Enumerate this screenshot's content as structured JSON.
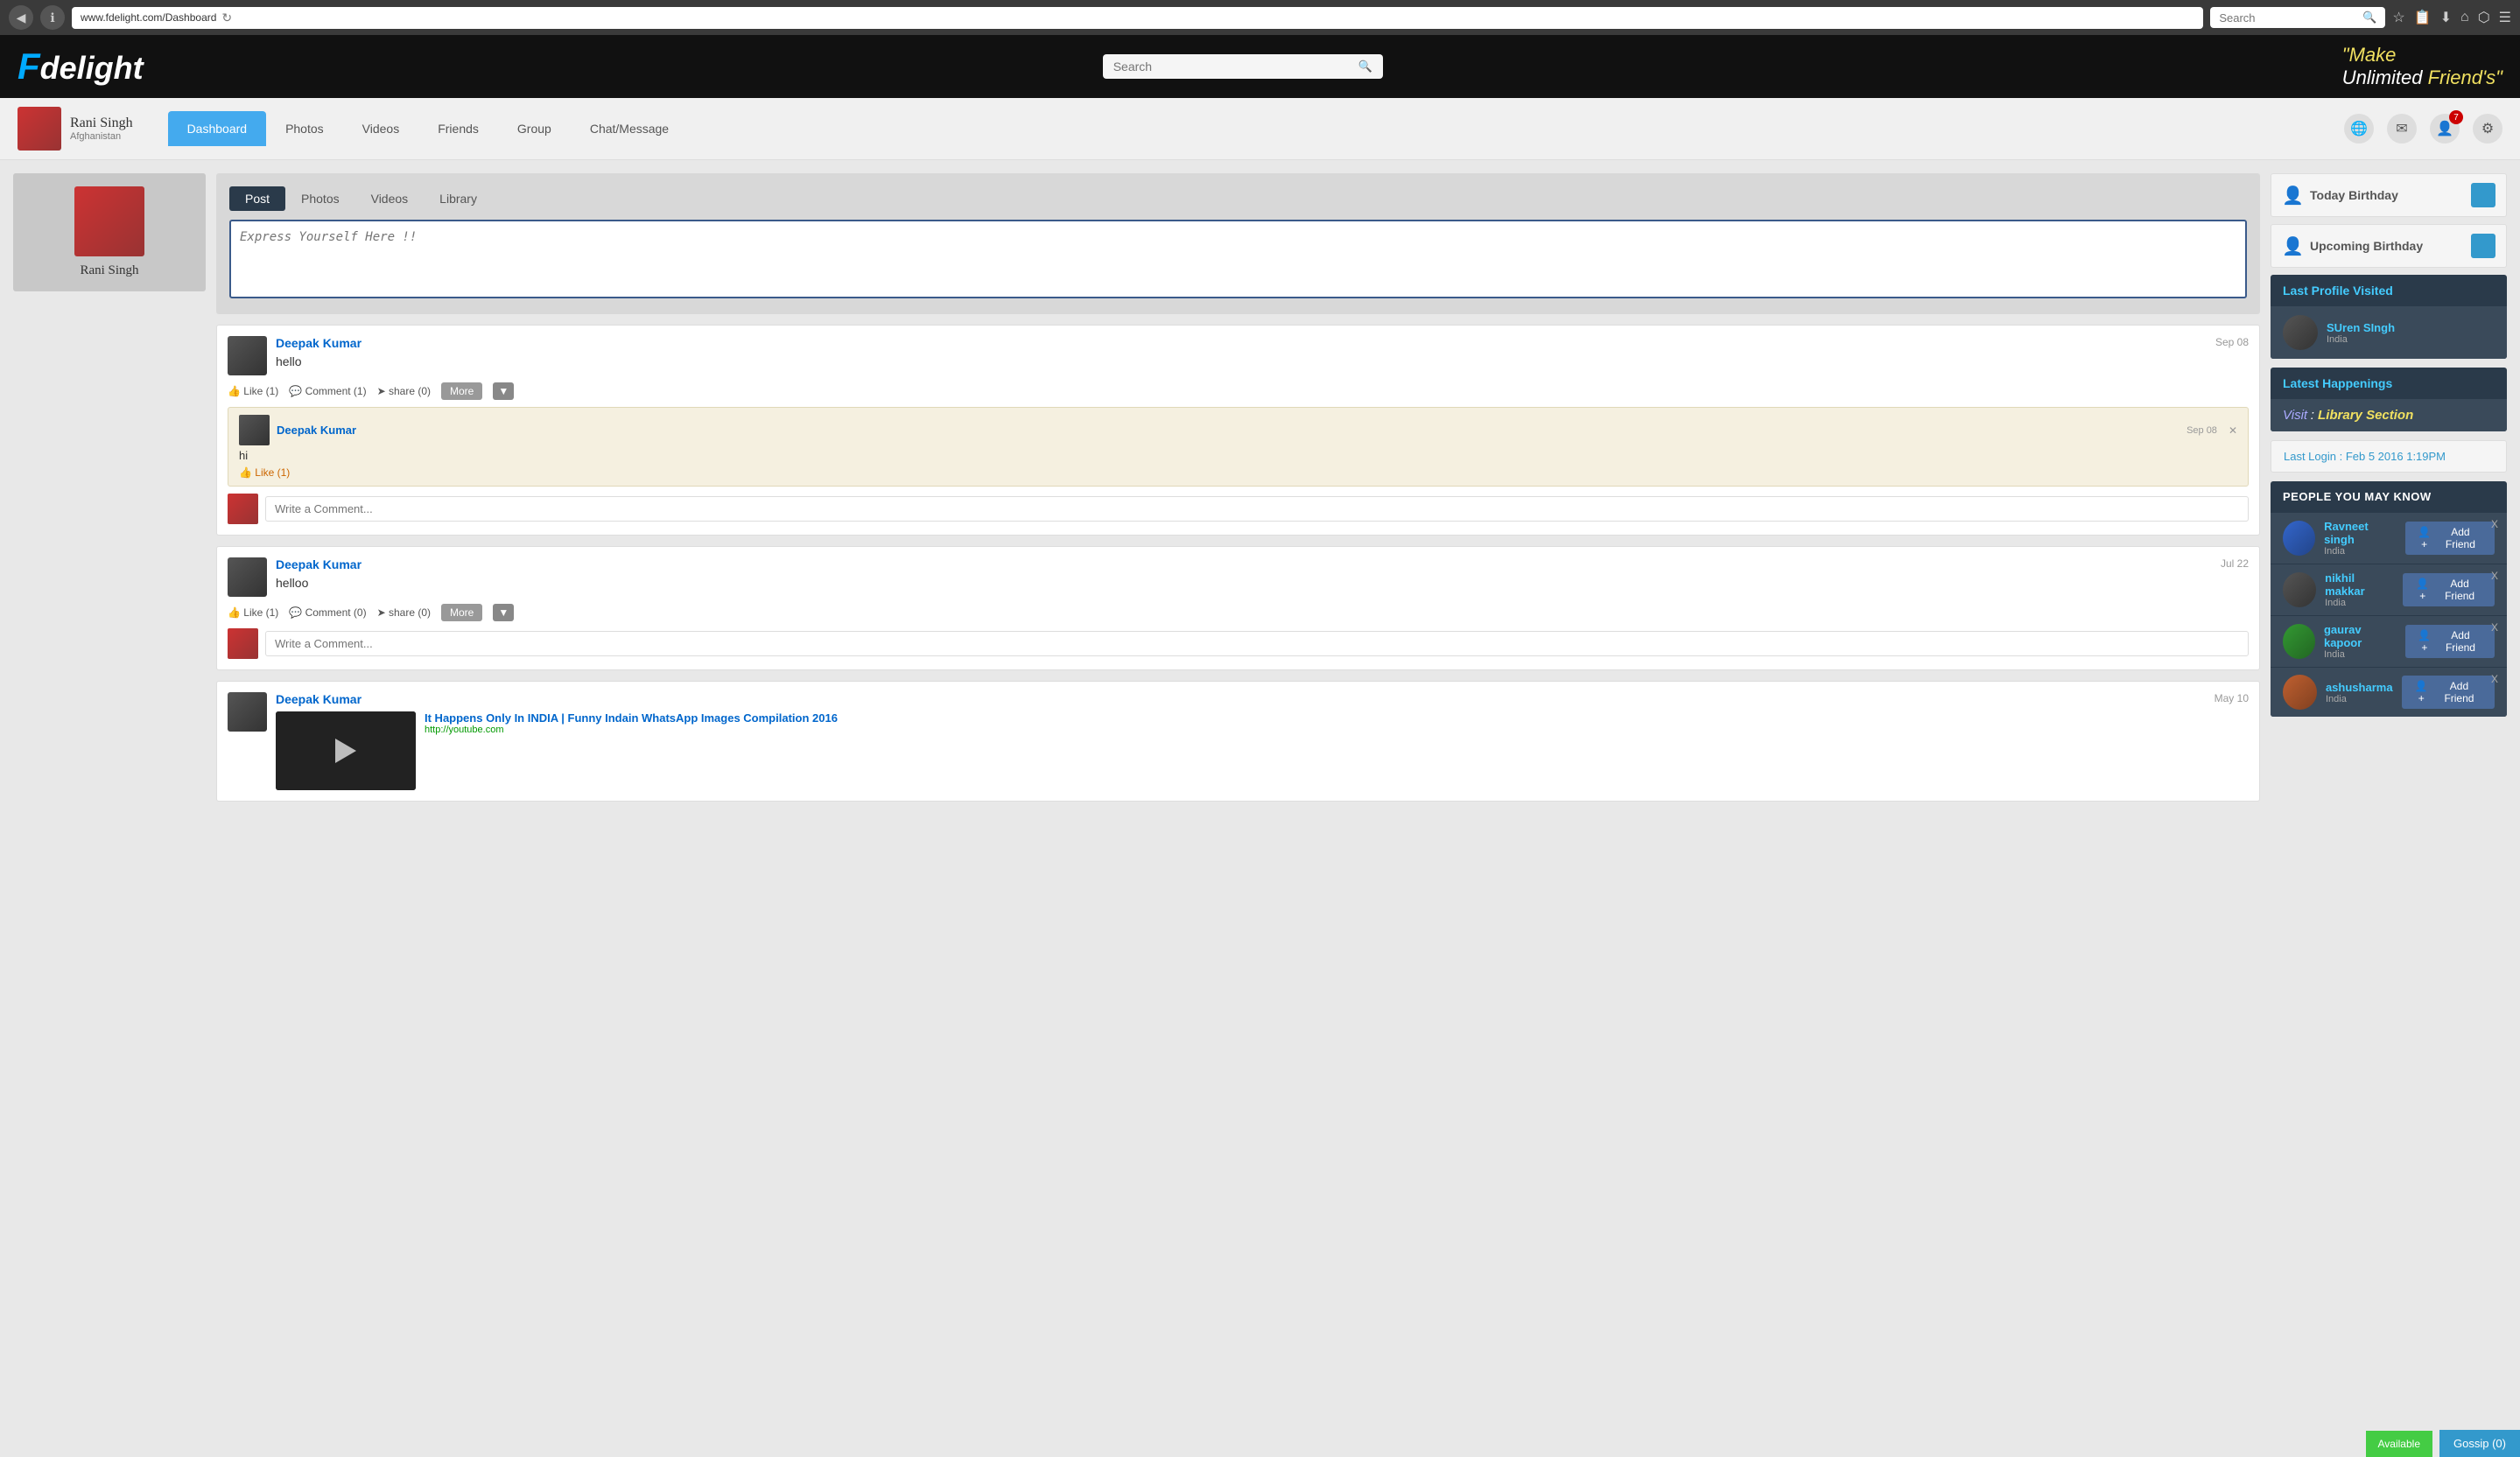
{
  "browser": {
    "url": "www.fdelight.com/Dashboard",
    "search_placeholder": "Search",
    "back_icon": "◀",
    "info_icon": "ℹ",
    "reload_icon": "↻",
    "star_icon": "☆",
    "bookmark_icon": "📋",
    "download_icon": "⬇",
    "home_icon": "⌂",
    "pocket_icon": "⬡",
    "menu_icon": "☰"
  },
  "header": {
    "logo_f": "F",
    "logo_rest": "delight",
    "search_placeholder": "Search",
    "tagline_line1": "\"Make",
    "tagline_line2": "Unlimited Friend's\""
  },
  "nav": {
    "user_name": "Rani Singh",
    "user_location": "Afghanistan",
    "tabs": [
      {
        "id": "dashboard",
        "label": "Dashboard",
        "active": true
      },
      {
        "id": "photos",
        "label": "Photos",
        "active": false
      },
      {
        "id": "videos",
        "label": "Videos",
        "active": false
      },
      {
        "id": "friends",
        "label": "Friends",
        "active": false
      },
      {
        "id": "group",
        "label": "Group",
        "active": false
      },
      {
        "id": "chat",
        "label": "Chat/Message",
        "active": false
      }
    ],
    "notification_count": "7"
  },
  "post_area": {
    "tabs": [
      "Post",
      "Photos",
      "Videos",
      "Library"
    ],
    "active_tab": "Post",
    "placeholder": "Express Yourself Here !!"
  },
  "feed": [
    {
      "id": "feed1",
      "user": "Deepak Kumar",
      "text": "hello",
      "date": "Sep 08",
      "like_count": "1",
      "comment_count": "1",
      "share_count": "0",
      "comment": {
        "user": "Deepak Kumar",
        "text": "hi",
        "date": "Sep 08",
        "like_count": "1"
      },
      "comment_placeholder": "Write a Comment..."
    },
    {
      "id": "feed2",
      "user": "Deepak Kumar",
      "text": "helloo",
      "date": "Jul 22",
      "like_count": "1",
      "comment_count": "0",
      "share_count": "0",
      "comment_placeholder": "Write a Comment..."
    },
    {
      "id": "feed3",
      "user": "Deepak Kumar",
      "text": "",
      "date": "May 10",
      "video_title": "It Happens Only In INDIA | Funny Indain WhatsApp Images Compilation 2016",
      "video_url": "http://youtube.com"
    }
  ],
  "right_sidebar": {
    "today_birthday_label": "Today Birthday",
    "upcoming_birthday_label": "Upcoming Birthday",
    "last_profile_section": "Last Profile Visited",
    "last_profile_name": "SUren SIngh",
    "last_profile_country": "India",
    "happenings_section": "Latest Happenings",
    "happenings_visit": "Visit",
    "happenings_colon": "  :  ",
    "happenings_library": "Library Section",
    "last_login_label": "Last Login : Feb 5 2016 1:19PM",
    "people_section": "PEOPLE YOU MAY KNOW",
    "people": [
      {
        "name": "Ravneet singh",
        "country": "India"
      },
      {
        "name": "nikhil makkar",
        "country": "India"
      },
      {
        "name": "gaurav kapoor",
        "country": "India"
      },
      {
        "name": "ashusharma",
        "country": "India"
      }
    ],
    "add_friend_label": "Add Friend"
  },
  "gossip": {
    "label": "Gossip (0)",
    "available": "Available"
  },
  "actions": {
    "like": "Like",
    "comment": "Comment",
    "share": "share",
    "more": "More"
  }
}
